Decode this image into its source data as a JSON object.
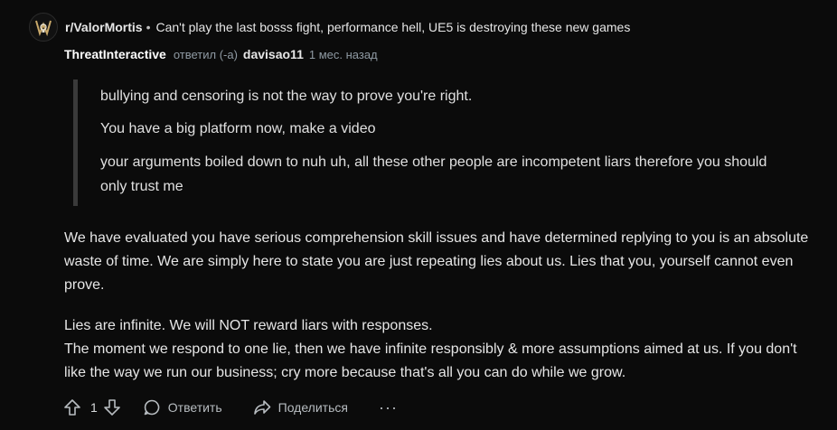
{
  "header": {
    "avatar_icon": "skull-avatar-icon",
    "subreddit": "r/ValorMortis",
    "separator": "•",
    "post_title": "Can't play the last bosss fight, performance hell, UE5 is destroying these new games"
  },
  "meta": {
    "author": "ThreatInteractive",
    "replied_text": "ответил (-а)",
    "reply_to": "davisao11",
    "time": "1 мес. назад"
  },
  "quote": {
    "line1": "bullying and censoring is not the way to prove you're right.",
    "line2": "You have a big platform now, make a video",
    "line3": "your arguments boiled down to nuh uh, all these other people are incompetent liars therefore you should only trust me"
  },
  "body": {
    "p1": "We have evaluated you have serious comprehension skill issues and have determined replying to you is an absolute waste of time. We are simply here to state you are just repeating lies about us. Lies that you, yourself cannot even prove.",
    "p2_line1": "Lies are infinite. We will NOT reward liars with responses.",
    "p2_line2": "The moment we respond to one lie, then we have infinite responsibly & more assumptions aimed at us. If you don't like the way we run our business; cry more because that's all you can do while we grow."
  },
  "actions": {
    "vote_count": "1",
    "reply_label": "Ответить",
    "share_label": "Поделиться",
    "more_label": "···"
  },
  "colors": {
    "background": "#0b0b0b",
    "text": "#e6e6e6",
    "muted": "#8f9aa3",
    "quote_bar": "#3a3a3a"
  }
}
